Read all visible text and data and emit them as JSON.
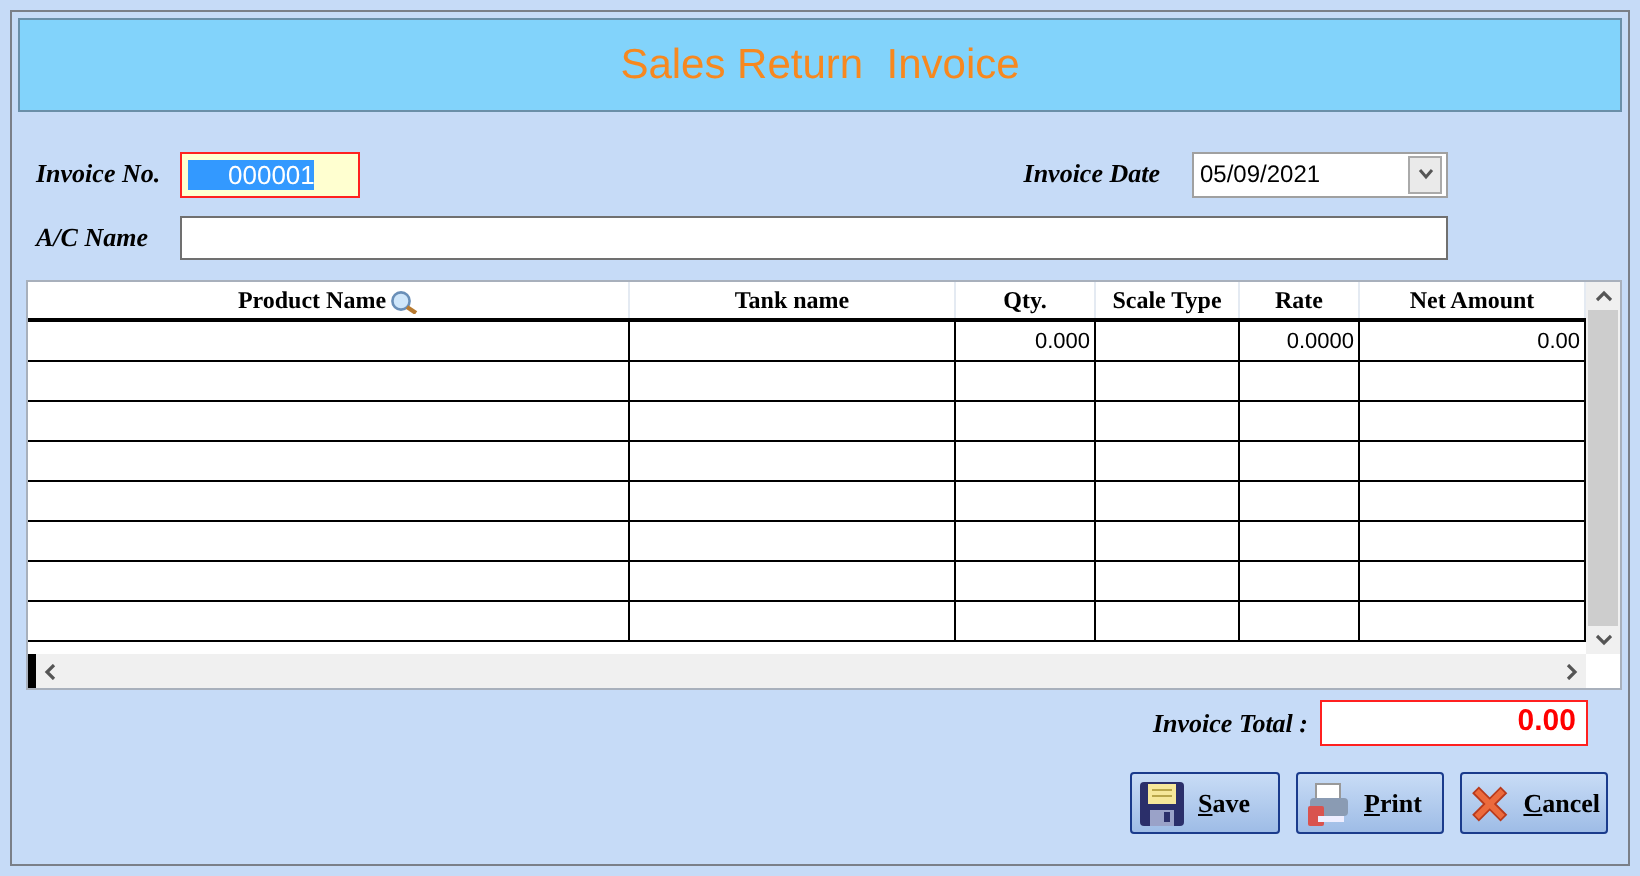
{
  "window": {
    "title": "Sales Return  Invoice"
  },
  "form": {
    "invoice_no": {
      "label": "Invoice No.",
      "value": "000001",
      "selected": true
    },
    "invoice_date": {
      "label": "Invoice Date",
      "value": "05/09/2021"
    },
    "ac_name": {
      "label": "A/C Name"
    }
  },
  "table": {
    "columns": [
      {
        "label": "Product Name",
        "search_icon": true
      },
      {
        "label": "Tank name"
      },
      {
        "label": "Qty."
      },
      {
        "label": "Scale Type"
      },
      {
        "label": "Rate"
      },
      {
        "label": "Net Amount"
      }
    ],
    "rows": [
      [
        null,
        null,
        "0.000",
        null,
        "0.0000",
        "0.00"
      ],
      [],
      [],
      [],
      [],
      [],
      [],
      []
    ]
  },
  "invoice_total": {
    "label": "Invoice Total :",
    "value": "0.00"
  },
  "buttons": [
    {
      "kind": "save",
      "label": "Save"
    },
    {
      "kind": "print",
      "label": "Print"
    },
    {
      "kind": "cancel",
      "label": "Cancel"
    }
  ]
}
